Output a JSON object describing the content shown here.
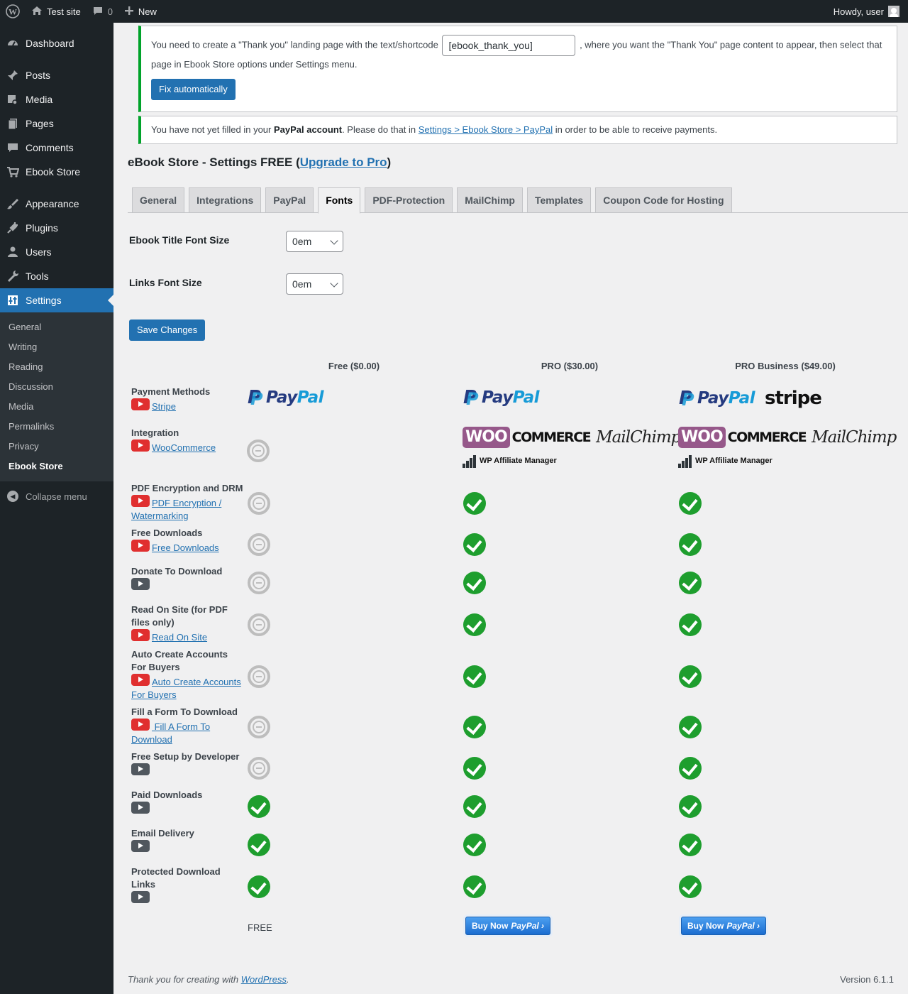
{
  "adminbar": {
    "site_name": "Test site",
    "comments_count": "0",
    "new_label": "New",
    "howdy": "Howdy, user"
  },
  "sidebar": {
    "items": [
      {
        "label": "Dashboard",
        "icon": "dashboard-icon"
      },
      {
        "label": "Posts",
        "icon": "pin-icon"
      },
      {
        "label": "Media",
        "icon": "media-icon"
      },
      {
        "label": "Pages",
        "icon": "pages-icon"
      },
      {
        "label": "Comments",
        "icon": "comment-icon"
      },
      {
        "label": "Ebook Store",
        "icon": "cart-icon"
      },
      {
        "label": "Appearance",
        "icon": "brush-icon"
      },
      {
        "label": "Plugins",
        "icon": "plug-icon"
      },
      {
        "label": "Users",
        "icon": "user-icon"
      },
      {
        "label": "Tools",
        "icon": "wrench-icon"
      },
      {
        "label": "Settings",
        "icon": "settings-icon"
      }
    ],
    "submenu": [
      "General",
      "Writing",
      "Reading",
      "Discussion",
      "Media",
      "Permalinks",
      "Privacy",
      "Ebook Store"
    ],
    "collapse": "Collapse menu"
  },
  "notice1": {
    "text_before": "You need to create a \"Thank you\" landing page with the text/shortcode",
    "shortcode_value": "[ebook_thank_you]",
    "text_after": ", where you want the \"Thank You\" page content to appear, then select that page in Ebook Store options under Settings menu.",
    "button": "Fix automatically"
  },
  "notice2": {
    "text_before": "You have not yet filled in your ",
    "bold": "PayPal account",
    "text_mid": ". Please do that in ",
    "link": "Settings > Ebook Store > PayPal",
    "text_after": " in order to be able to receive payments."
  },
  "page": {
    "title_before": "eBook Store - Settings FREE (",
    "title_link": "Upgrade to Pro",
    "title_after": ")"
  },
  "tabs": [
    "General",
    "Integrations",
    "PayPal",
    "Fonts",
    "PDF-Protection",
    "MailChimp",
    "Templates",
    "Coupon Code for Hosting"
  ],
  "active_tab": "Fonts",
  "form": {
    "title_font_label": "Ebook Title Font Size",
    "title_font_value": "0em",
    "links_font_label": "Links Font Size",
    "links_font_value": "0em",
    "save": "Save Changes"
  },
  "comparison": {
    "columns": [
      "Free ($0.00)",
      "PRO ($30.00)",
      "PRO Business ($49.00)"
    ],
    "logos": {
      "paypal_a": "Pay",
      "paypal_b": "Pal",
      "stripe": "stripe",
      "woo_a": "WOO",
      "woo_b": "COMMERCE",
      "mailchimp": "MailChimp",
      "wpam": "WP Affiliate Manager"
    },
    "rows": [
      {
        "name": "Payment Methods",
        "link": "Stripe",
        "video": "red"
      },
      {
        "name": "Integration",
        "link": "WooCommerce",
        "video": "red"
      },
      {
        "name": "PDF Encryption and DRM",
        "link": "PDF Encryption / Watermarking",
        "video": "red",
        "free": "no",
        "pro": "yes",
        "biz": "yes"
      },
      {
        "name": "Free Downloads",
        "link": "Free Downloads",
        "video": "red",
        "free": "no",
        "pro": "yes",
        "biz": "yes"
      },
      {
        "name": "Donate To Download",
        "link": "",
        "video": "gray",
        "free": "no",
        "pro": "yes",
        "biz": "yes"
      },
      {
        "name": "Read On Site (for PDF files only)",
        "link": "Read On Site",
        "video": "red",
        "free": "no",
        "pro": "yes",
        "biz": "yes"
      },
      {
        "name": "Auto Create Accounts For Buyers",
        "link": "Auto Create Accounts For Buyers",
        "video": "red",
        "free": "no",
        "pro": "yes",
        "biz": "yes"
      },
      {
        "name": "Fill a Form To Download",
        "link": " Fill A Form To Download",
        "video": "red",
        "free": "no",
        "pro": "yes",
        "biz": "yes"
      },
      {
        "name": "Free Setup by Developer",
        "link": "",
        "video": "gray",
        "free": "no",
        "pro": "yes",
        "biz": "yes"
      },
      {
        "name": "Paid Downloads",
        "link": "",
        "video": "gray",
        "free": "yes",
        "pro": "yes",
        "biz": "yes"
      },
      {
        "name": "Email Delivery",
        "link": "",
        "video": "gray",
        "free": "yes",
        "pro": "yes",
        "biz": "yes"
      },
      {
        "name": "Protected Download Links",
        "link": "",
        "video": "gray",
        "free": "yes",
        "pro": "yes",
        "biz": "yes"
      }
    ],
    "free_label": "FREE",
    "buy_a": "Buy Now",
    "buy_b": "PayPal ›"
  },
  "footer": {
    "thanks_before": "Thank you for creating with ",
    "wp_link": "WordPress",
    "thanks_after": ".",
    "version": "Version 6.1.1"
  },
  "colors": {
    "accent": "#2271b1",
    "sidebar": "#1d2327",
    "notice_border": "#00a32a",
    "check_green": "#1e9e2e"
  }
}
